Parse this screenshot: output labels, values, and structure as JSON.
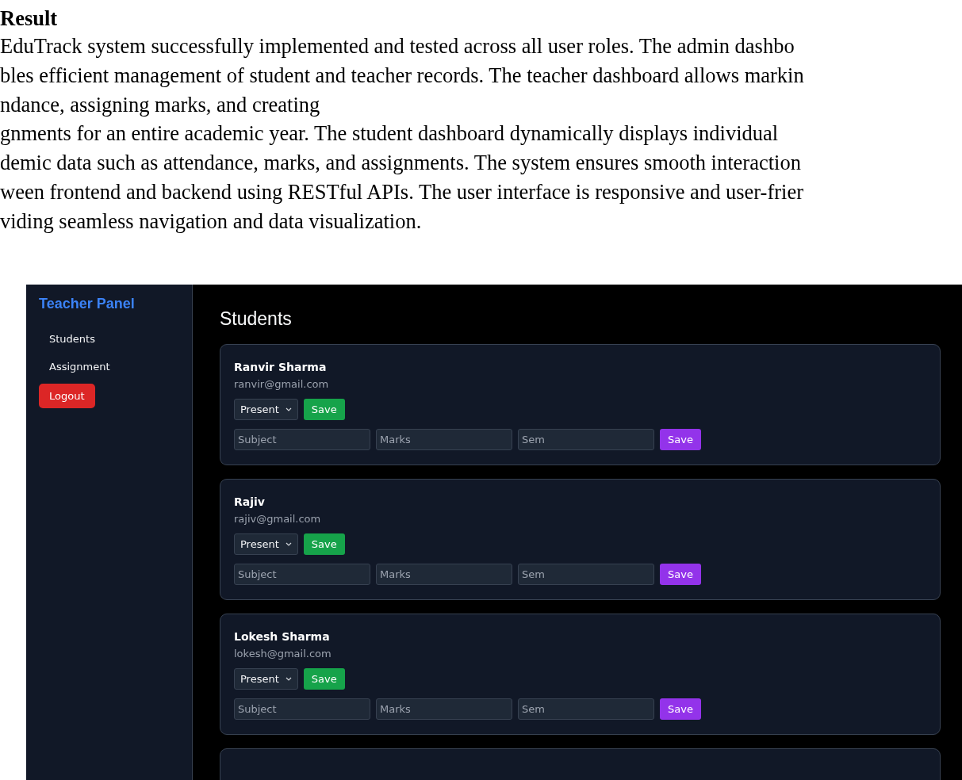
{
  "document": {
    "heading": "Result",
    "lines": [
      "EduTrack system successfully implemented and tested across all user roles. The admin dashbo",
      "bles efficient management of student and teacher records. The teacher dashboard allows markin",
      "ndance, assigning marks, and creating",
      "gnments for an entire academic year. The student dashboard dynamically displays individual",
      "demic data such as attendance, marks, and assignments. The system ensures smooth interaction",
      "ween frontend and backend using RESTful APIs. The user interface is responsive and user-frier",
      "viding seamless navigation and data visualization."
    ]
  },
  "screenshot": {
    "sidebar": {
      "title": "Teacher Panel",
      "items": [
        {
          "label": "Students"
        },
        {
          "label": "Assignment"
        }
      ],
      "logout": "Logout"
    },
    "main": {
      "title": "Students",
      "students": [
        {
          "name": "Ranvir Sharma",
          "email": "ranvir@gmail.com",
          "attendance": "Present",
          "save": "Save",
          "fields": [
            {
              "placeholder": "Subject"
            },
            {
              "placeholder": "Marks"
            },
            {
              "placeholder": "Sem"
            }
          ],
          "marks_save": "Save"
        },
        {
          "name": "Rajiv",
          "email": "rajiv@gmail.com",
          "attendance": "Present",
          "save": "Save",
          "fields": [
            {
              "placeholder": "Subject"
            },
            {
              "placeholder": "Marks"
            },
            {
              "placeholder": "Sem"
            }
          ],
          "marks_save": "Save"
        },
        {
          "name": "Lokesh Sharma",
          "email": "lokesh@gmail.com",
          "attendance": "Present",
          "save": "Save",
          "fields": [
            {
              "placeholder": "Subject"
            },
            {
              "placeholder": "Marks"
            },
            {
              "placeholder": "Sem"
            }
          ],
          "marks_save": "Save"
        }
      ]
    }
  }
}
